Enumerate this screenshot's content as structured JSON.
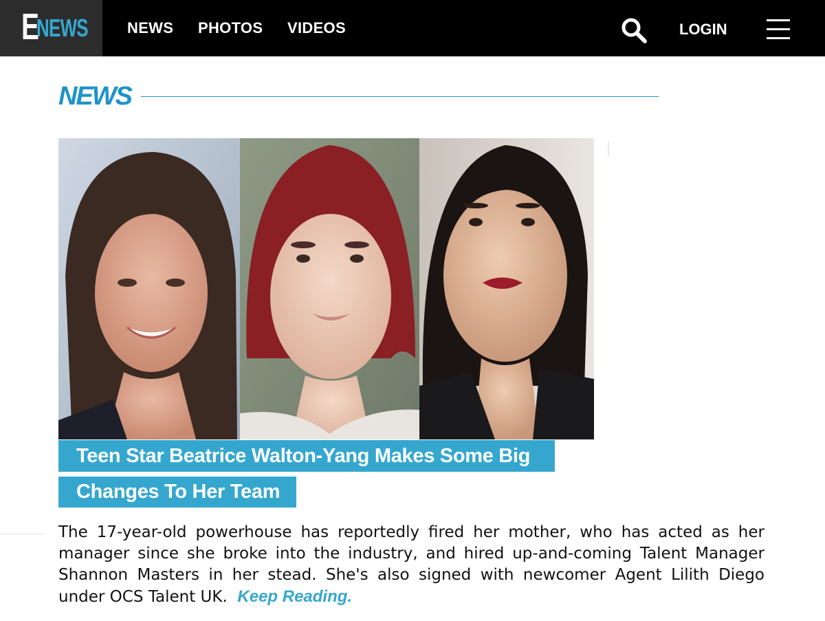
{
  "header": {
    "logo_letter": "E",
    "logo_word": "NEWS",
    "nav": [
      "NEWS",
      "PHOTOS",
      "VIDEOS"
    ],
    "login_label": "LOGIN",
    "search_icon": "search-icon",
    "menu_icon": "hamburger-menu-icon"
  },
  "section": {
    "title": "NEWS"
  },
  "article": {
    "photos": [
      {
        "name": "photo-woman-dark-hair-smiling"
      },
      {
        "name": "photo-teen-red-hair"
      },
      {
        "name": "photo-woman-slicked-hair-red-lips"
      }
    ],
    "headline_line1": "Teen Star Beatrice Walton-Yang Makes Some Big",
    "headline_line2": "Changes To Her Team",
    "body": "The 17-year-old powerhouse has reportedly fired her mother, who has acted as her manager since she broke into the industry, and hired up-and-coming Talent Manager Shannon Masters in her stead. She's also signed with newcomer Agent Lilith Diego under OCS Talent UK.",
    "keep_reading": "Keep Reading."
  },
  "colors": {
    "accent": "#35a7cf",
    "heading_blue": "#1f93c8",
    "topbar": "#000000",
    "logo_bg": "#2d2d2d"
  }
}
